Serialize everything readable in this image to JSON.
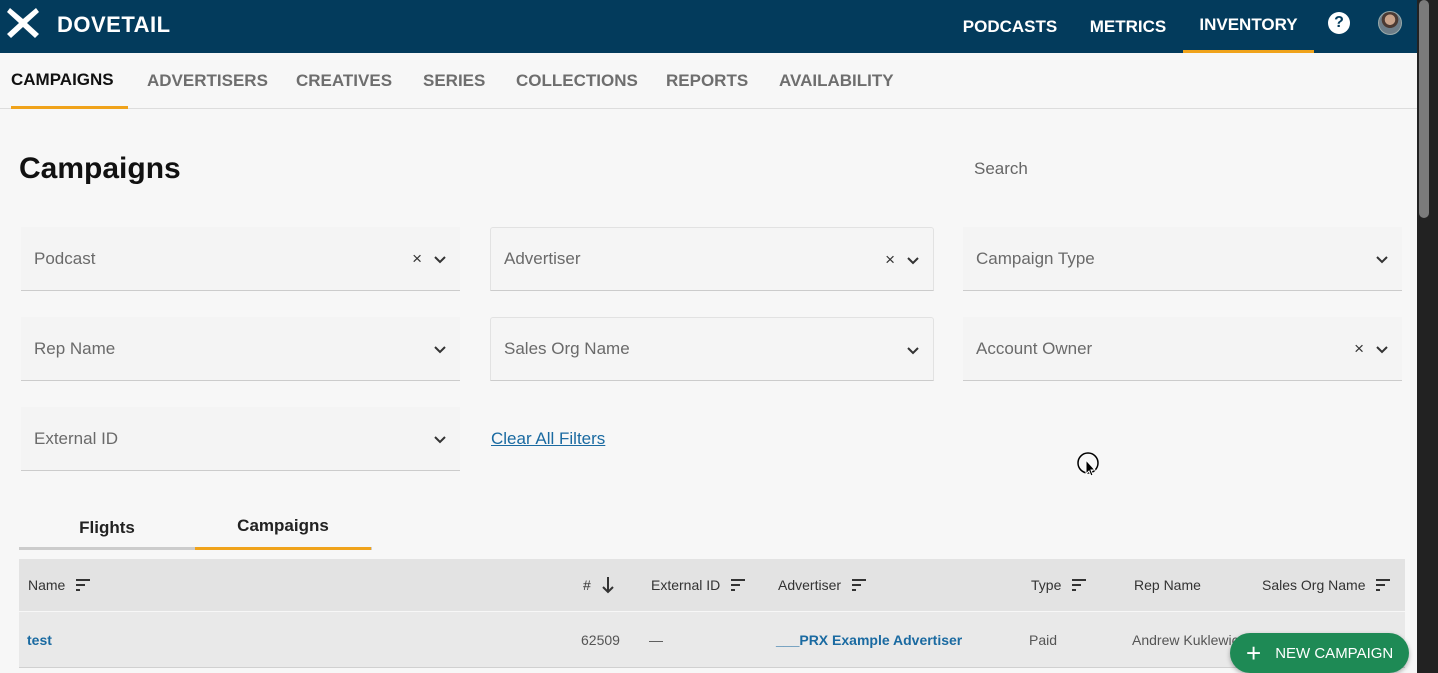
{
  "header": {
    "brand": "DOVETAIL",
    "nav": [
      "PODCASTS",
      "METRICS",
      "INVENTORY"
    ],
    "active_nav": "INVENTORY",
    "help_label": "?"
  },
  "subnav": {
    "tabs": [
      "CAMPAIGNS",
      "ADVERTISERS",
      "CREATIVES",
      "SERIES",
      "COLLECTIONS",
      "REPORTS",
      "AVAILABILITY"
    ],
    "active": "CAMPAIGNS"
  },
  "page": {
    "title": "Campaigns",
    "search_placeholder": "Search"
  },
  "filters": {
    "podcast": "Podcast",
    "advertiser": "Advertiser",
    "campaign_type": "Campaign Type",
    "rep_name": "Rep Name",
    "sales_org_name": "Sales Org Name",
    "account_owner": "Account Owner",
    "external_id": "External ID",
    "clear_symbol": "×",
    "clear_all": "Clear All Filters"
  },
  "view_tabs": {
    "flights": "Flights",
    "campaigns": "Campaigns",
    "active": "Campaigns"
  },
  "table": {
    "columns": {
      "name": "Name",
      "number": "#",
      "external_id": "External ID",
      "advertiser": "Advertiser",
      "type": "Type",
      "rep_name": "Rep Name",
      "sales_org_name": "Sales Org Name"
    },
    "rows": [
      {
        "name": "test",
        "number": "62509",
        "external_id": "—",
        "advertiser": "___PRX Example Advertiser",
        "type": "Paid",
        "rep_name": "Andrew Kuklewic"
      }
    ]
  },
  "fab": {
    "icon": "+",
    "label": "NEW CAMPAIGN"
  },
  "colors": {
    "header_bg": "#033b5c",
    "accent": "#f0a31b",
    "link": "#1a6aa1",
    "fab": "#1e8a55"
  }
}
